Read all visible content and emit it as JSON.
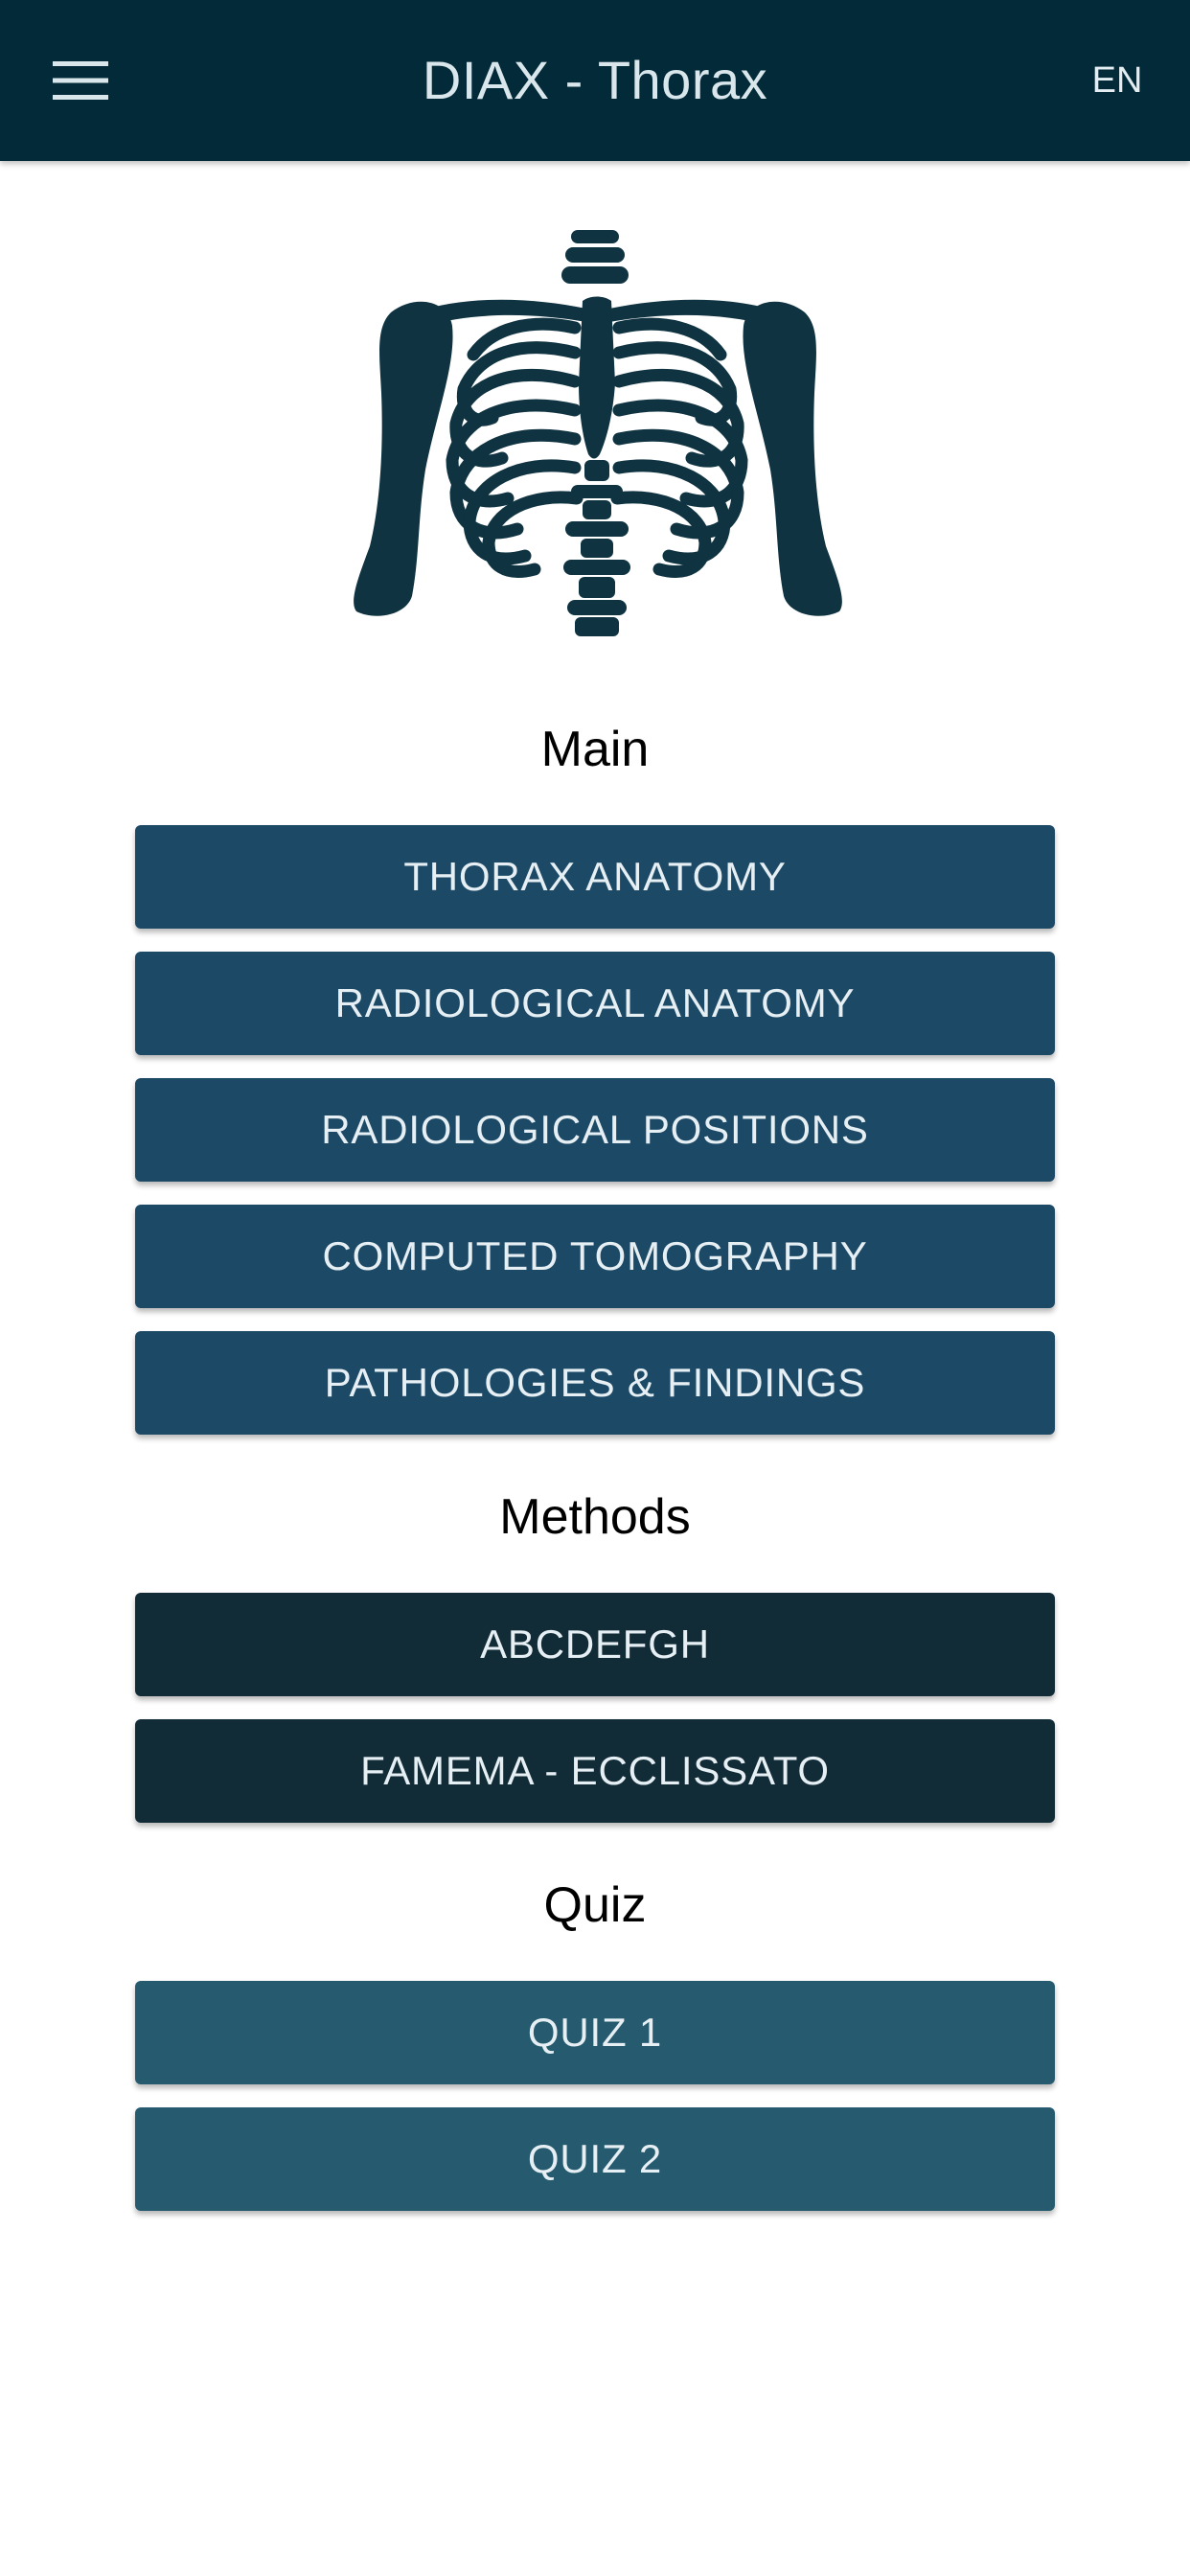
{
  "app_bar": {
    "title": "DIAX - Thorax",
    "language": "EN",
    "menu_icon": "hamburger-menu-icon",
    "background_color": "#032a38"
  },
  "hero": {
    "icon": "ribcage-skeleton-illustration",
    "color": "#0f3341"
  },
  "sections": {
    "main": {
      "heading": "Main",
      "button_color": "#1c4966",
      "buttons": [
        "THORAX ANATOMY",
        "RADIOLOGICAL ANATOMY",
        "RADIOLOGICAL POSITIONS",
        "COMPUTED TOMOGRAPHY",
        "PATHOLOGIES & FINDINGS"
      ]
    },
    "methods": {
      "heading": "Methods",
      "button_color": "#112b37",
      "buttons": [
        "ABCDEFGH",
        "FAMEMA - ECCLISSATO"
      ]
    },
    "quiz": {
      "heading": "Quiz",
      "button_color": "#265b6f",
      "buttons": [
        "QUIZ 1",
        "QUIZ 2"
      ]
    }
  }
}
